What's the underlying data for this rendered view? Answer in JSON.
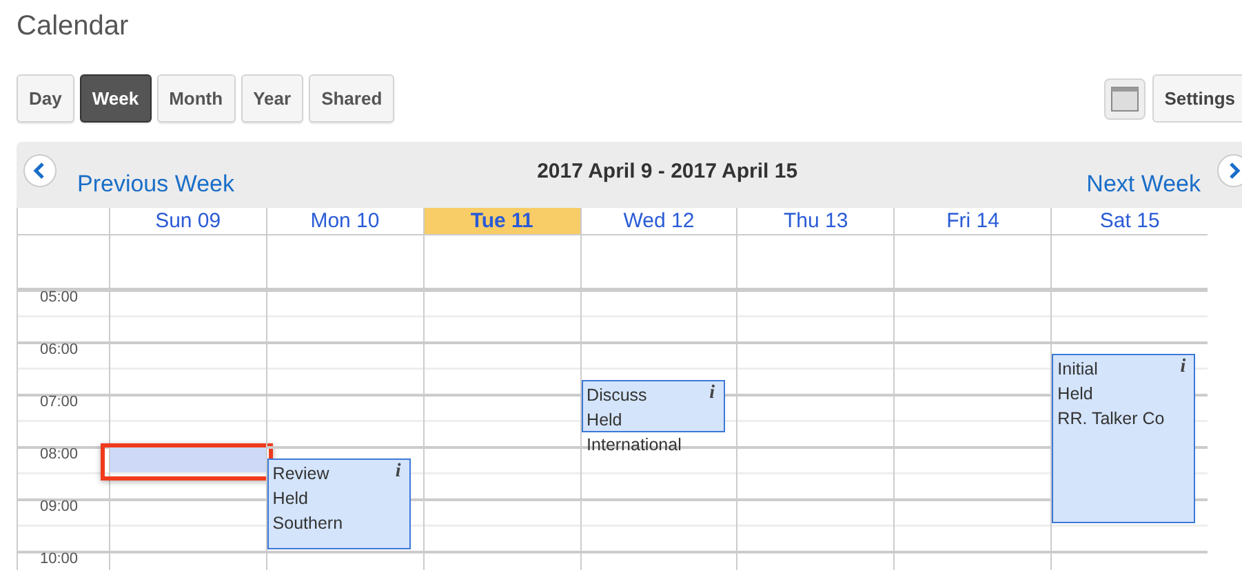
{
  "title": "Calendar",
  "views": [
    {
      "label": "Day",
      "selected": false
    },
    {
      "label": "Week",
      "selected": true
    },
    {
      "label": "Month",
      "selected": false
    },
    {
      "label": "Year",
      "selected": false
    },
    {
      "label": "Shared",
      "selected": false
    }
  ],
  "settings_button": "Settings",
  "nav": {
    "previous": "Previous Week",
    "range": "2017 April 9 - 2017 April 15",
    "next": "Next Week"
  },
  "times": [
    "05:00",
    "06:00",
    "07:00",
    "08:00",
    "09:00",
    "10:00"
  ],
  "days": [
    {
      "label": "Sun 09",
      "today": false,
      "has_selected_slot": true
    },
    {
      "label": "Mon 10",
      "today": false,
      "has_selected_slot": false,
      "events": [
        {
          "lines": [
            "Review",
            "Held",
            "Southern"
          ],
          "info": "i"
        }
      ]
    },
    {
      "label": "Tue 11",
      "today": true,
      "has_selected_slot": false
    },
    {
      "label": "Wed 12",
      "today": false,
      "has_selected_slot": false,
      "events": [
        {
          "lines": [
            "Discuss",
            "Held",
            "International"
          ],
          "info": "i"
        }
      ]
    },
    {
      "label": "Thu 13",
      "today": false,
      "has_selected_slot": false
    },
    {
      "label": "Fri 14",
      "today": false,
      "has_selected_slot": false
    },
    {
      "label": "Sat 15",
      "today": false,
      "has_selected_slot": false,
      "events": [
        {
          "lines": [
            "Initial",
            "Held",
            "RR. Talker Co"
          ],
          "info": "i"
        }
      ]
    }
  ]
}
